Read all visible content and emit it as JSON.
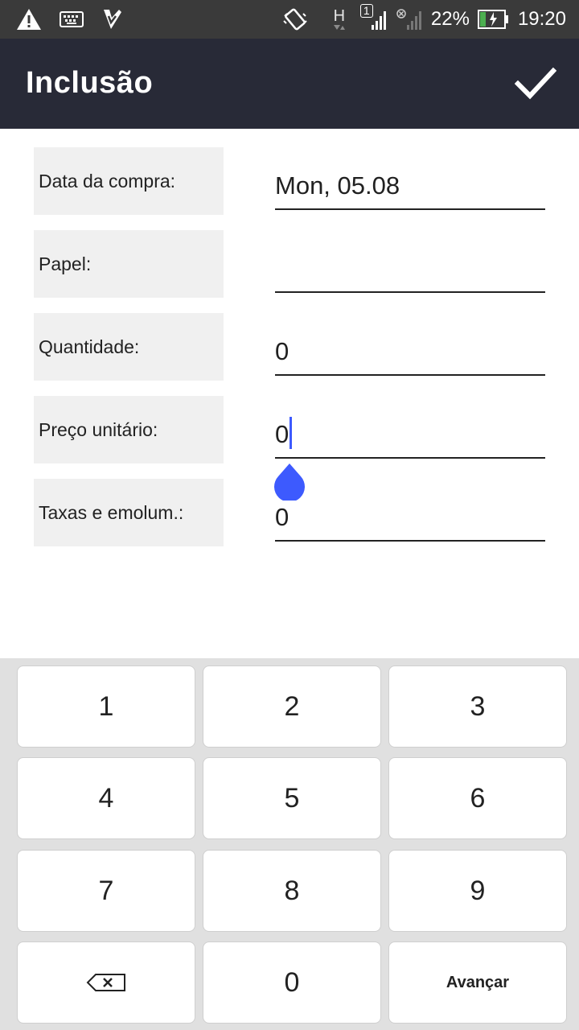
{
  "status_bar": {
    "battery": "22%",
    "time": "19:20",
    "network_type": "H",
    "sim_badge": "1",
    "icons": [
      "warning-icon",
      "keyboard-icon",
      "app-notification-icon",
      "vibrate-icon",
      "signal-icon",
      "no-signal-icon",
      "battery-charging-icon"
    ]
  },
  "toolbar": {
    "title": "Inclusão",
    "confirm_icon": "check-icon"
  },
  "form": {
    "purchase_date": {
      "label": "Data da compra:",
      "value": "Mon, 05.08"
    },
    "paper": {
      "label": "Papel:",
      "value": ""
    },
    "quantity": {
      "label": "Quantidade:",
      "value": "0"
    },
    "unit_price": {
      "label": "Preço unitário:",
      "value": "0"
    },
    "fees": {
      "label": "Taxas e emolum.:",
      "value": "0"
    }
  },
  "keypad": {
    "keys": [
      "1",
      "2",
      "3",
      "4",
      "5",
      "6",
      "7",
      "8",
      "9",
      "0"
    ],
    "backspace_icon": "backspace-icon",
    "next_label": "Avançar"
  },
  "colors": {
    "toolbar_bg": "#282a37",
    "status_bg": "#3a3a3a",
    "accent": "#3d5afe",
    "label_bg": "#f0f0f0",
    "keypad_bg": "#e0e0e0"
  }
}
